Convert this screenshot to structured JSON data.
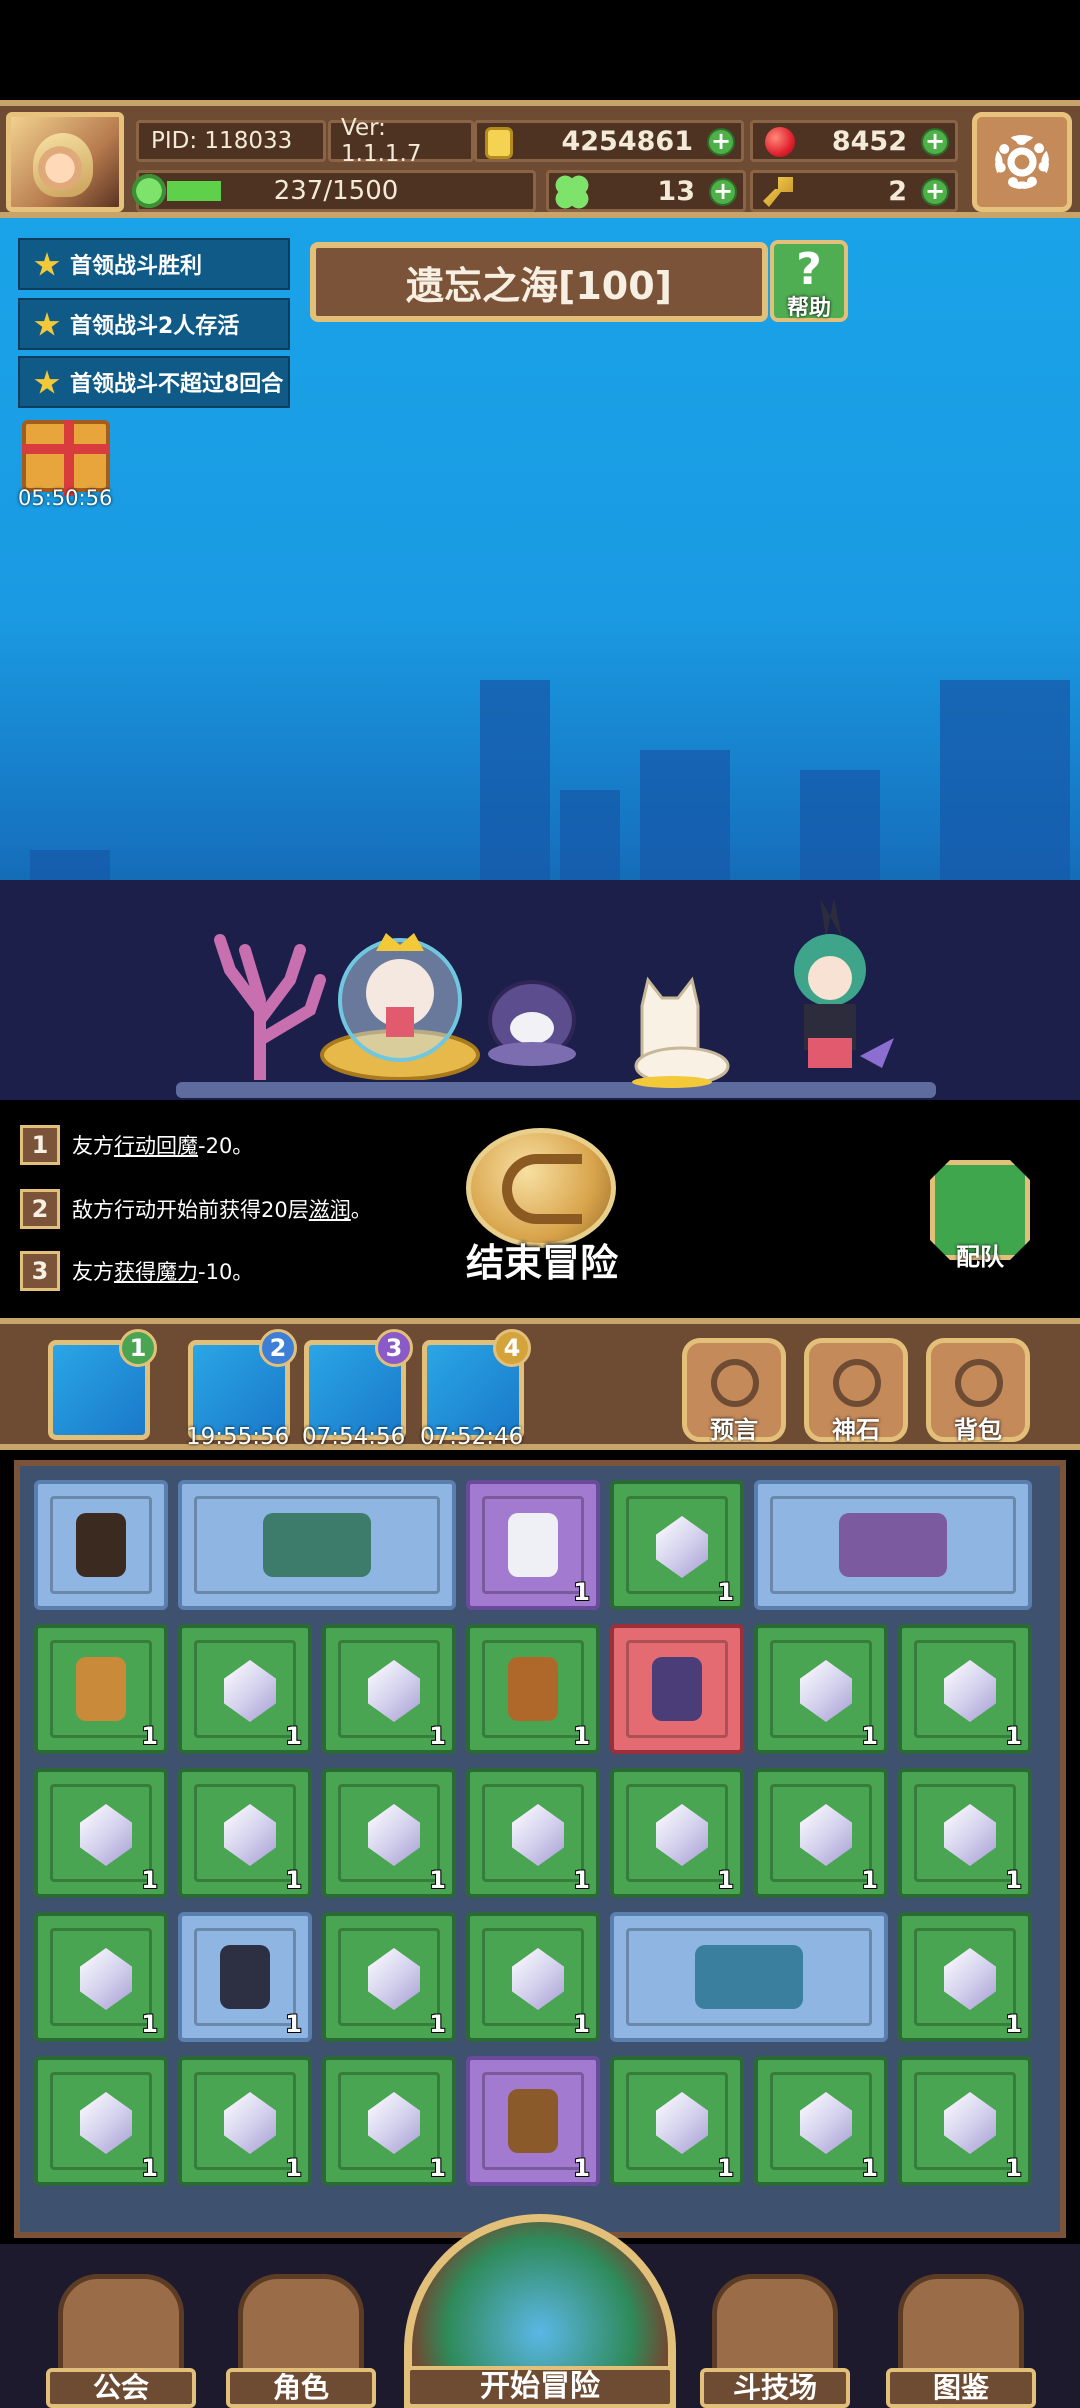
{
  "hud": {
    "pid": "PID: 118033",
    "version": "Ver: 1.1.1.7",
    "gold": "4254861",
    "gems": "8452",
    "energy": "237/1500",
    "energy_fraction": 0.158,
    "clover": "13",
    "keys": "2"
  },
  "objectives": [
    "首领战斗胜利",
    "首领战斗2人存活",
    "首领战斗不超过8回合"
  ],
  "stage": {
    "title": "遗忘之海[100]",
    "help_label": "帮助"
  },
  "gift": {
    "timer": "05:50:56"
  },
  "effects": [
    {
      "num": "1",
      "pre": "友方",
      "u": "行动回魔",
      "post": "-20。"
    },
    {
      "num": "2",
      "pre": "敌方行动开始前获得20层",
      "u": "滋润",
      "post": "。"
    },
    {
      "num": "3",
      "pre": "友方",
      "u": "获得魔力",
      "post": "-10。"
    }
  ],
  "actions": {
    "end_adventure": "结束冒险",
    "team": "配队"
  },
  "party": {
    "slots": [
      {
        "badge": "1",
        "timer": ""
      },
      {
        "badge": "2",
        "timer": "19:55:56"
      },
      {
        "badge": "3",
        "timer": "07:54:56"
      },
      {
        "badge": "4",
        "timer": "07:52:46"
      }
    ],
    "buttons": [
      "预言",
      "神石",
      "背包"
    ]
  },
  "inventory": {
    "rows": [
      [
        {
          "kind": "cauldron",
          "qty": ""
        },
        {
          "kind": "island",
          "qty": ""
        },
        {
          "kind": "fish",
          "qty": "1"
        },
        {
          "kind": "crystal",
          "qty": "1"
        },
        {
          "kind": "anemone",
          "qty": ""
        }
      ],
      [
        {
          "kind": "chest-gold",
          "qty": "1"
        },
        {
          "kind": "crystal",
          "qty": "1"
        },
        {
          "kind": "crystal",
          "qty": "1"
        },
        {
          "kind": "stick",
          "qty": "1"
        },
        {
          "kind": "clam",
          "qty": ""
        },
        {
          "kind": "crystal",
          "qty": "1"
        },
        {
          "kind": "crystal",
          "qty": "1"
        }
      ],
      [
        {
          "kind": "crystal",
          "qty": "1"
        },
        {
          "kind": "crystal",
          "qty": "1"
        },
        {
          "kind": "crystal",
          "qty": "1"
        },
        {
          "kind": "crystal",
          "qty": "1"
        },
        {
          "kind": "crystal",
          "qty": "1"
        },
        {
          "kind": "crystal",
          "qty": "1"
        },
        {
          "kind": "crystal",
          "qty": "1"
        }
      ],
      [
        {
          "kind": "crystal",
          "qty": "1"
        },
        {
          "kind": "shark",
          "qty": "1"
        },
        {
          "kind": "crystal",
          "qty": "1"
        },
        {
          "kind": "crystal",
          "qty": "1"
        },
        {
          "kind": "ruins",
          "qty": ""
        },
        {
          "kind": "crystal",
          "qty": "1"
        }
      ],
      [
        {
          "kind": "crystal",
          "qty": "1"
        },
        {
          "kind": "crystal",
          "qty": "1"
        },
        {
          "kind": "crystal",
          "qty": "1"
        },
        {
          "kind": "chest-wood",
          "qty": "1"
        },
        {
          "kind": "crystal",
          "qty": "1"
        },
        {
          "kind": "crystal",
          "qty": "1"
        },
        {
          "kind": "crystal",
          "qty": "1"
        }
      ]
    ]
  },
  "nav": {
    "guild": "公会",
    "character": "角色",
    "start": "开始冒险",
    "arena": "斗技场",
    "codex": "图鉴"
  },
  "colors": {
    "sea": "#1aa3e8",
    "wood": "#6e4b33",
    "trim": "#e3c07a",
    "green_cell": "#4aa552",
    "purple_cell": "#a27ad0",
    "blue_cell": "#8fb6e3",
    "red_cell": "#e46b71"
  }
}
